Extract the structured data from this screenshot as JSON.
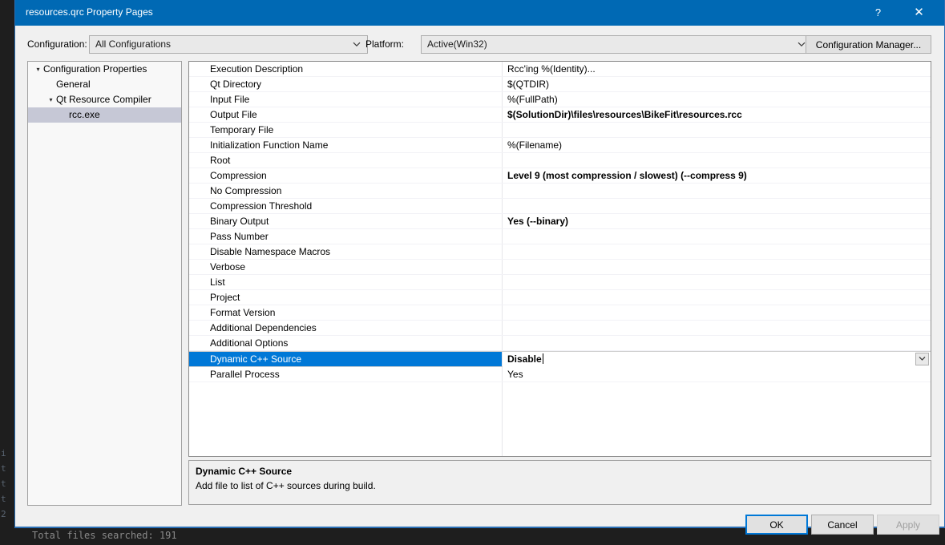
{
  "background": {
    "gutter_lines": "i\nt\nt\nt\n2",
    "status_text": "Total files searched: 191"
  },
  "titlebar": {
    "title": "resources.qrc Property Pages",
    "help_glyph": "?",
    "close_glyph": "✕"
  },
  "config_bar": {
    "configuration_label": "Configuration:",
    "configuration_value": "All Configurations",
    "platform_label": "Platform:",
    "platform_value": "Active(Win32)",
    "configuration_manager_label": "Configuration Manager..."
  },
  "tree": {
    "items": [
      {
        "label": "Configuration Properties",
        "depth": 0,
        "twisty": "▾",
        "selected": false
      },
      {
        "label": "General",
        "depth": 1,
        "twisty": "",
        "selected": false
      },
      {
        "label": "Qt Resource Compiler",
        "depth": 1,
        "twisty": "▾",
        "selected": false
      },
      {
        "label": "rcc.exe",
        "depth": 2,
        "twisty": "",
        "selected": true
      }
    ]
  },
  "grid": {
    "rows": [
      {
        "name": "Execution Description",
        "value": "Rcc'ing %(Identity)...",
        "bold": false,
        "selected": false,
        "editing": false
      },
      {
        "name": "Qt Directory",
        "value": "$(QTDIR)",
        "bold": false,
        "selected": false,
        "editing": false
      },
      {
        "name": "Input File",
        "value": "%(FullPath)",
        "bold": false,
        "selected": false,
        "editing": false
      },
      {
        "name": "Output File",
        "value": "$(SolutionDir)\\files\\resources\\BikeFit\\resources.rcc",
        "bold": true,
        "selected": false,
        "editing": false
      },
      {
        "name": "Temporary File",
        "value": "",
        "bold": false,
        "selected": false,
        "editing": false
      },
      {
        "name": "Initialization Function Name",
        "value": "%(Filename)",
        "bold": false,
        "selected": false,
        "editing": false
      },
      {
        "name": "Root",
        "value": "",
        "bold": false,
        "selected": false,
        "editing": false
      },
      {
        "name": "Compression",
        "value": "Level 9 (most compression / slowest) (--compress 9)",
        "bold": true,
        "selected": false,
        "editing": false
      },
      {
        "name": "No Compression",
        "value": "",
        "bold": false,
        "selected": false,
        "editing": false
      },
      {
        "name": "Compression Threshold",
        "value": "",
        "bold": false,
        "selected": false,
        "editing": false
      },
      {
        "name": "Binary Output",
        "value": "Yes (--binary)",
        "bold": true,
        "selected": false,
        "editing": false
      },
      {
        "name": "Pass Number",
        "value": "",
        "bold": false,
        "selected": false,
        "editing": false
      },
      {
        "name": "Disable Namespace Macros",
        "value": "",
        "bold": false,
        "selected": false,
        "editing": false
      },
      {
        "name": "Verbose",
        "value": "",
        "bold": false,
        "selected": false,
        "editing": false
      },
      {
        "name": "List",
        "value": "",
        "bold": false,
        "selected": false,
        "editing": false
      },
      {
        "name": "Project",
        "value": "",
        "bold": false,
        "selected": false,
        "editing": false
      },
      {
        "name": "Format Version",
        "value": "",
        "bold": false,
        "selected": false,
        "editing": false
      },
      {
        "name": "Additional Dependencies",
        "value": "",
        "bold": false,
        "selected": false,
        "editing": false
      },
      {
        "name": "Additional Options",
        "value": "",
        "bold": false,
        "selected": false,
        "editing": false
      },
      {
        "name": "Dynamic C++ Source",
        "value": "Disable",
        "bold": true,
        "selected": true,
        "editing": true
      },
      {
        "name": "Parallel Process",
        "value": "Yes",
        "bold": false,
        "selected": false,
        "editing": false
      }
    ]
  },
  "description": {
    "title": "Dynamic C++ Source",
    "body": "Add file to list of C++ sources during build."
  },
  "footer": {
    "ok_label": "OK",
    "cancel_label": "Cancel",
    "apply_label": "Apply"
  },
  "colors": {
    "titlebar": "#0069b4",
    "selection": "#0078d7",
    "tree_selection": "#c6c8d6",
    "dialog_bg": "#f0f0f0"
  }
}
